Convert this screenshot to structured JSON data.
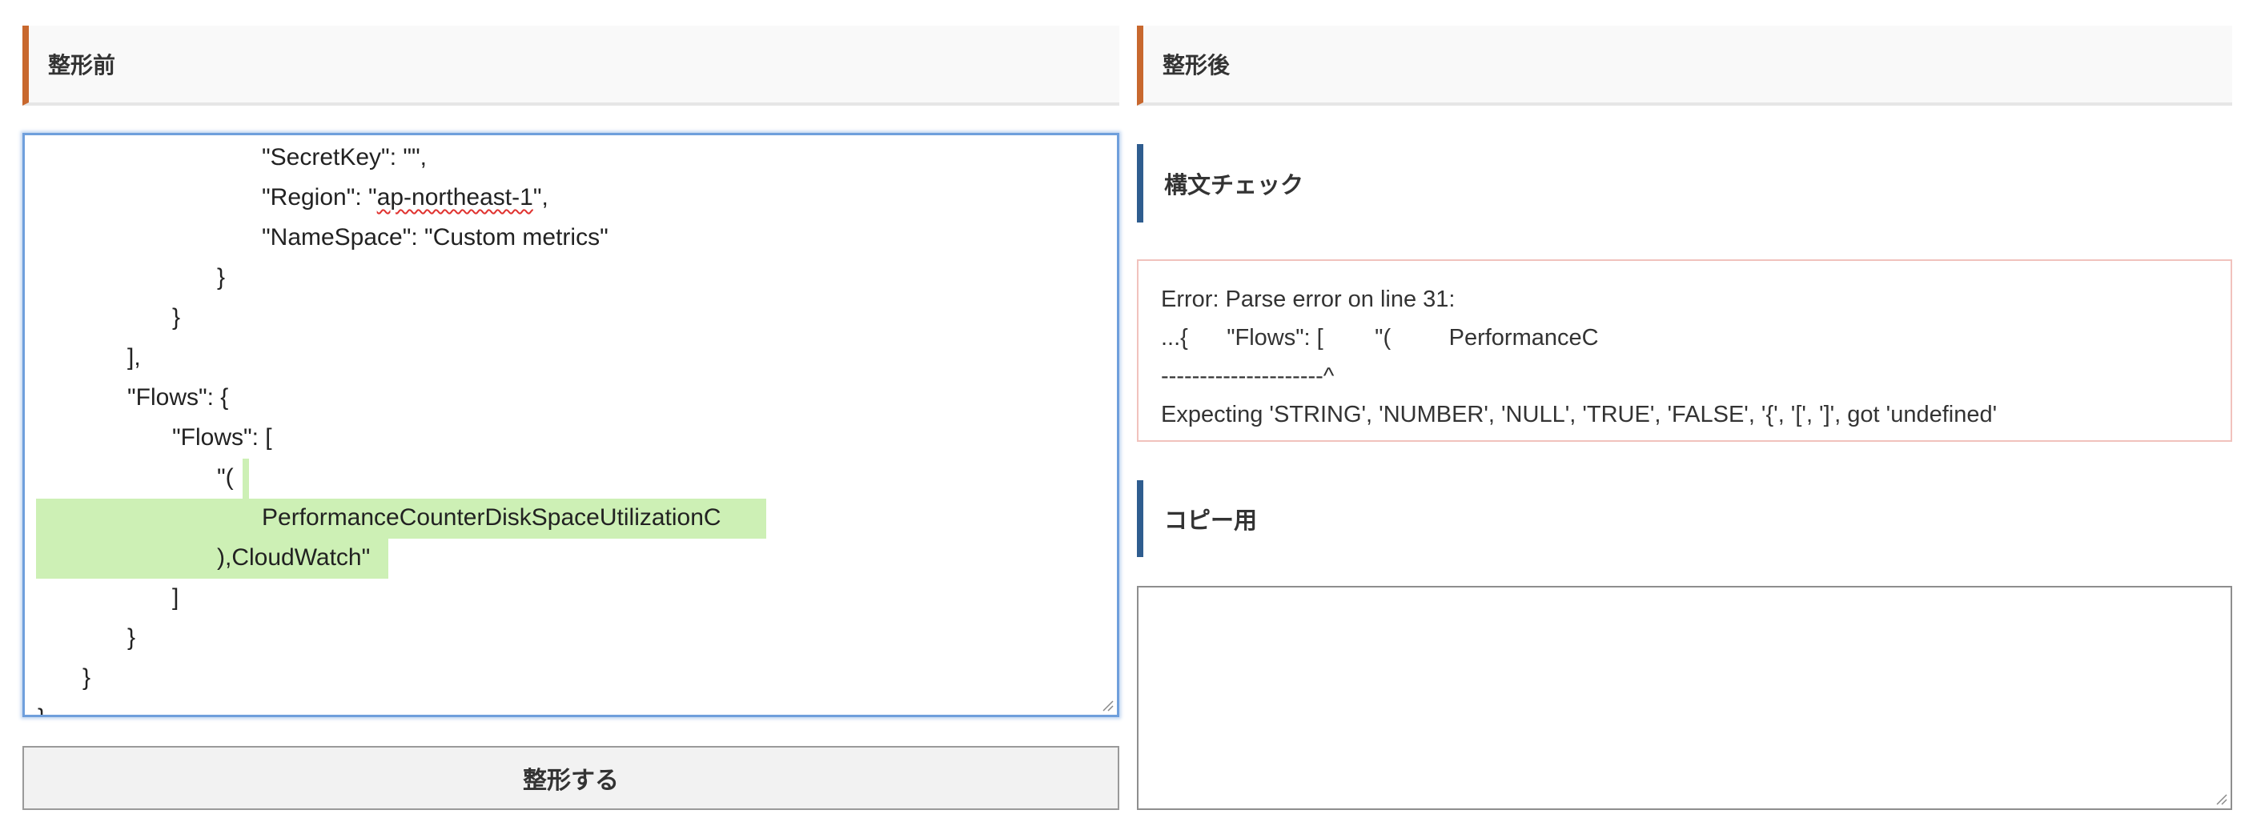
{
  "left_panel": {
    "title": "整形前",
    "editor_lines": [
      "\"SecretKey\": \"\",",
      "\"Region\": \"",
      "ap-northeast-1",
      "\",",
      "\"NameSpace\": \"Custom metrics\"",
      "}",
      "}",
      "],",
      "\"Flows\": {",
      "\"Flows\": [",
      "\"(",
      "PerformanceCounterDiskSpaceUtilizationC",
      "),CloudWatch\"",
      "]",
      "}",
      "}",
      "}"
    ],
    "format_button": "整形する"
  },
  "right_panel": {
    "title": "整形後",
    "syntax_check_title": "構文チェック",
    "error_lines": [
      "Error: Parse error on line 31:",
      "...{      \"Flows\": [        \"(         PerformanceC",
      "---------------------^",
      "Expecting 'STRING', 'NUMBER', 'NULL', 'TRUE', 'FALSE', '{', '[', ']', got 'undefined'"
    ],
    "copy_title": "コピー用",
    "copy_value": ""
  },
  "colors": {
    "accent_orange": "#c8682e",
    "accent_blue": "#2f5d8f",
    "highlight_green": "#cdf0b5",
    "error_border": "#f1c2bd",
    "focus_blue": "#6f9fdc"
  }
}
